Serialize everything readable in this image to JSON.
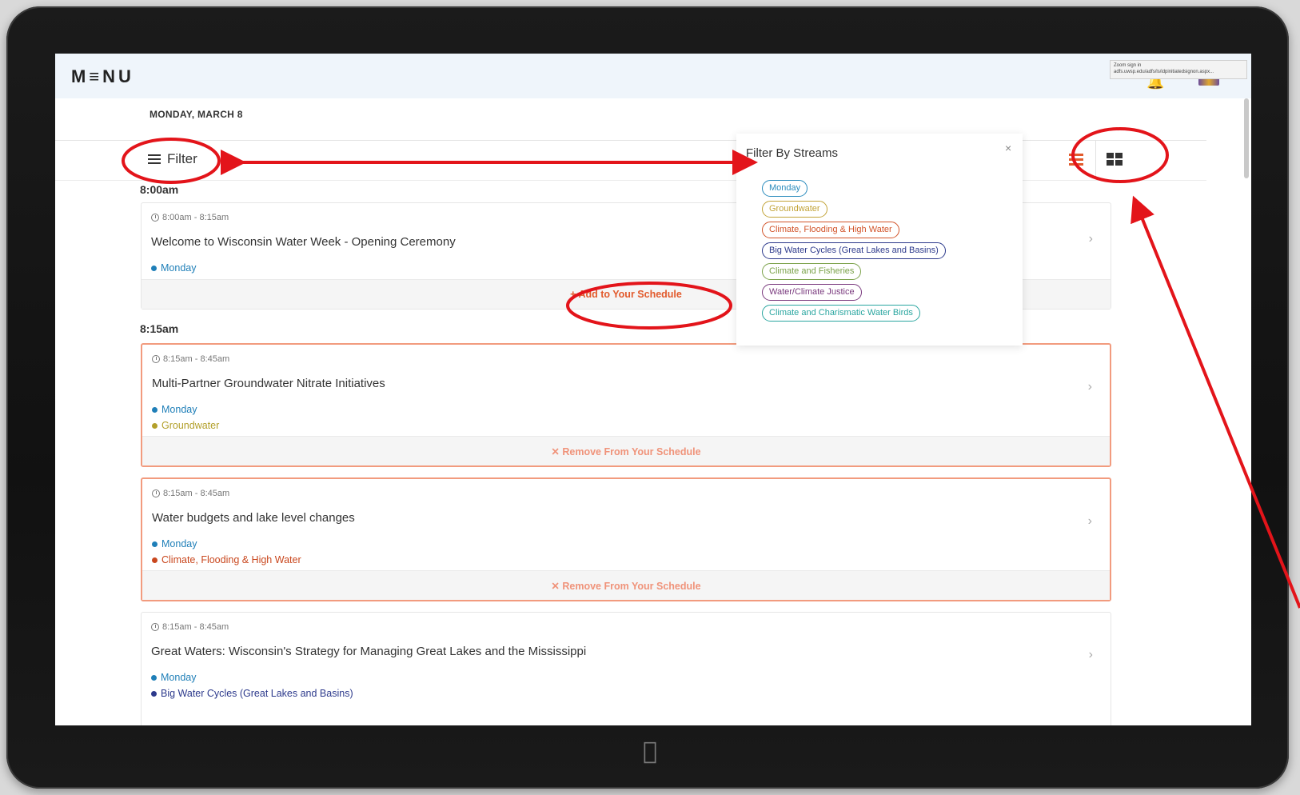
{
  "app": {
    "logo": "M≡NU",
    "tooltip_line1": "Zoom sign in",
    "tooltip_line2": "adfs.uwsp.edu/adfs/ls/idpinitiatedsignon.aspx..."
  },
  "header": {
    "date": "MONDAY, MARCH 8"
  },
  "toolbar": {
    "filter_label": "Filter",
    "icons": {
      "filter": "sliders-icon",
      "list_view": "list-view-icon",
      "grid_view": "grid-view-icon"
    }
  },
  "filter_panel": {
    "title": "Filter By Streams",
    "close_label": "×",
    "streams": [
      {
        "label": "Monday",
        "color": "#2a8bbd"
      },
      {
        "label": "Groundwater",
        "color": "#c2a338"
      },
      {
        "label": "Climate, Flooding & High Water",
        "color": "#d2542a"
      },
      {
        "label": "Big Water Cycles (Great Lakes and Basins)",
        "color": "#2d3a8c"
      },
      {
        "label": "Climate and Fisheries",
        "color": "#7ba24a"
      },
      {
        "label": "Water/Climate Justice",
        "color": "#7a3a7e"
      },
      {
        "label": "Climate and Charismatic Water Birds",
        "color": "#2aa6a0"
      }
    ]
  },
  "schedule": {
    "time_8_00": "8:00am",
    "time_8_15": "8:15am",
    "sessions": [
      {
        "time": "8:00am - 8:15am",
        "title": "Welcome to Wisconsin Water Week - Opening Ceremony",
        "tags": [
          {
            "label": "Monday",
            "color": "#1f7fb8"
          }
        ],
        "action": "+ Add to Your Schedule",
        "selected": false
      },
      {
        "time": "8:15am - 8:45am",
        "title": "Multi-Partner Groundwater Nitrate Initiatives",
        "tags": [
          {
            "label": "Monday",
            "color": "#1f7fb8"
          },
          {
            "label": "Groundwater",
            "color": "#b3a02b"
          }
        ],
        "action": "✕ Remove From Your Schedule",
        "selected": true
      },
      {
        "time": "8:15am - 8:45am",
        "title": "Water budgets and lake level changes",
        "tags": [
          {
            "label": "Monday",
            "color": "#1f7fb8"
          },
          {
            "label": "Climate, Flooding & High Water",
            "color": "#c9471e"
          }
        ],
        "action": "✕ Remove From Your Schedule",
        "selected": true
      },
      {
        "time": "8:15am - 8:45am",
        "title": "Great Waters: Wisconsin's Strategy for Managing Great Lakes and the Mississippi",
        "tags": [
          {
            "label": "Monday",
            "color": "#1f7fb8"
          },
          {
            "label": "Big Water Cycles (Great Lakes and Basins)",
            "color": "#2d3a8c"
          }
        ],
        "action": "",
        "selected": false
      }
    ]
  },
  "colors": {
    "accent": "#e25a2c",
    "annotation": "#e3141a",
    "selected_border": "#f29b7e"
  }
}
